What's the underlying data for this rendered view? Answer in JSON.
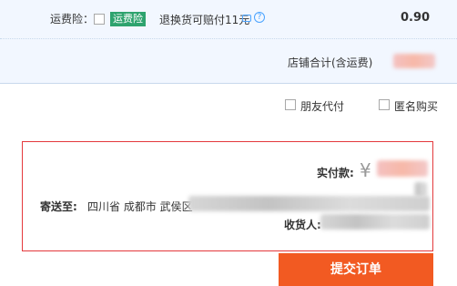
{
  "shipping_insurance": {
    "label": "运费险：",
    "badge": "运费险",
    "description": "退换货可赔付11元",
    "price": "0.90",
    "checked": false
  },
  "subtotal": {
    "label": "店铺合计(含运费)"
  },
  "options": {
    "friend_pay_label": "朋友代付",
    "anonymous_label": "匿名购买"
  },
  "confirm": {
    "paid_label": "实付款:",
    "currency_symbol": "¥",
    "ship_to_label": "寄送至:",
    "ship_to_address": "四川省 成都市 武侯区",
    "recipient_label": "收货人:"
  },
  "submit_button_label": "提交订单",
  "colors": {
    "accent": "#f25a22",
    "border_red": "#e4393c",
    "insurance_green": "#2ea36e",
    "row_background": "#f2f7ff"
  }
}
